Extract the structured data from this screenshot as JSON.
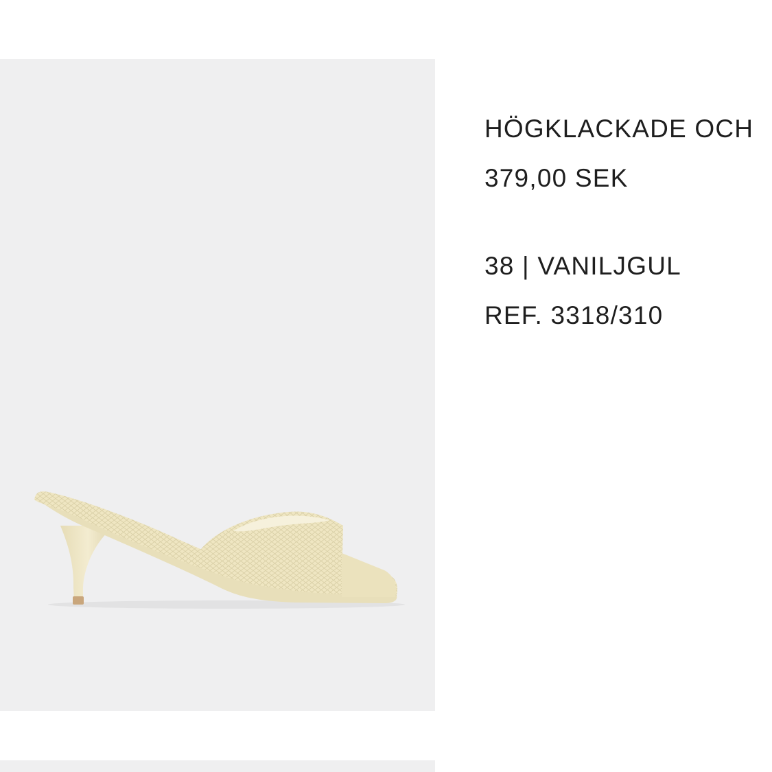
{
  "product": {
    "title": "HÖGKLACKADE OCH",
    "price": "379,00 SEK",
    "size": "38",
    "separator": "|",
    "color_name": "VANILJGUL",
    "reference": "REF. 3318/310"
  },
  "colors": {
    "image_background": "#efeff0",
    "shoe": "#efe7c4",
    "heel_tip": "#c9a67c",
    "text": "#1e1e1e"
  }
}
